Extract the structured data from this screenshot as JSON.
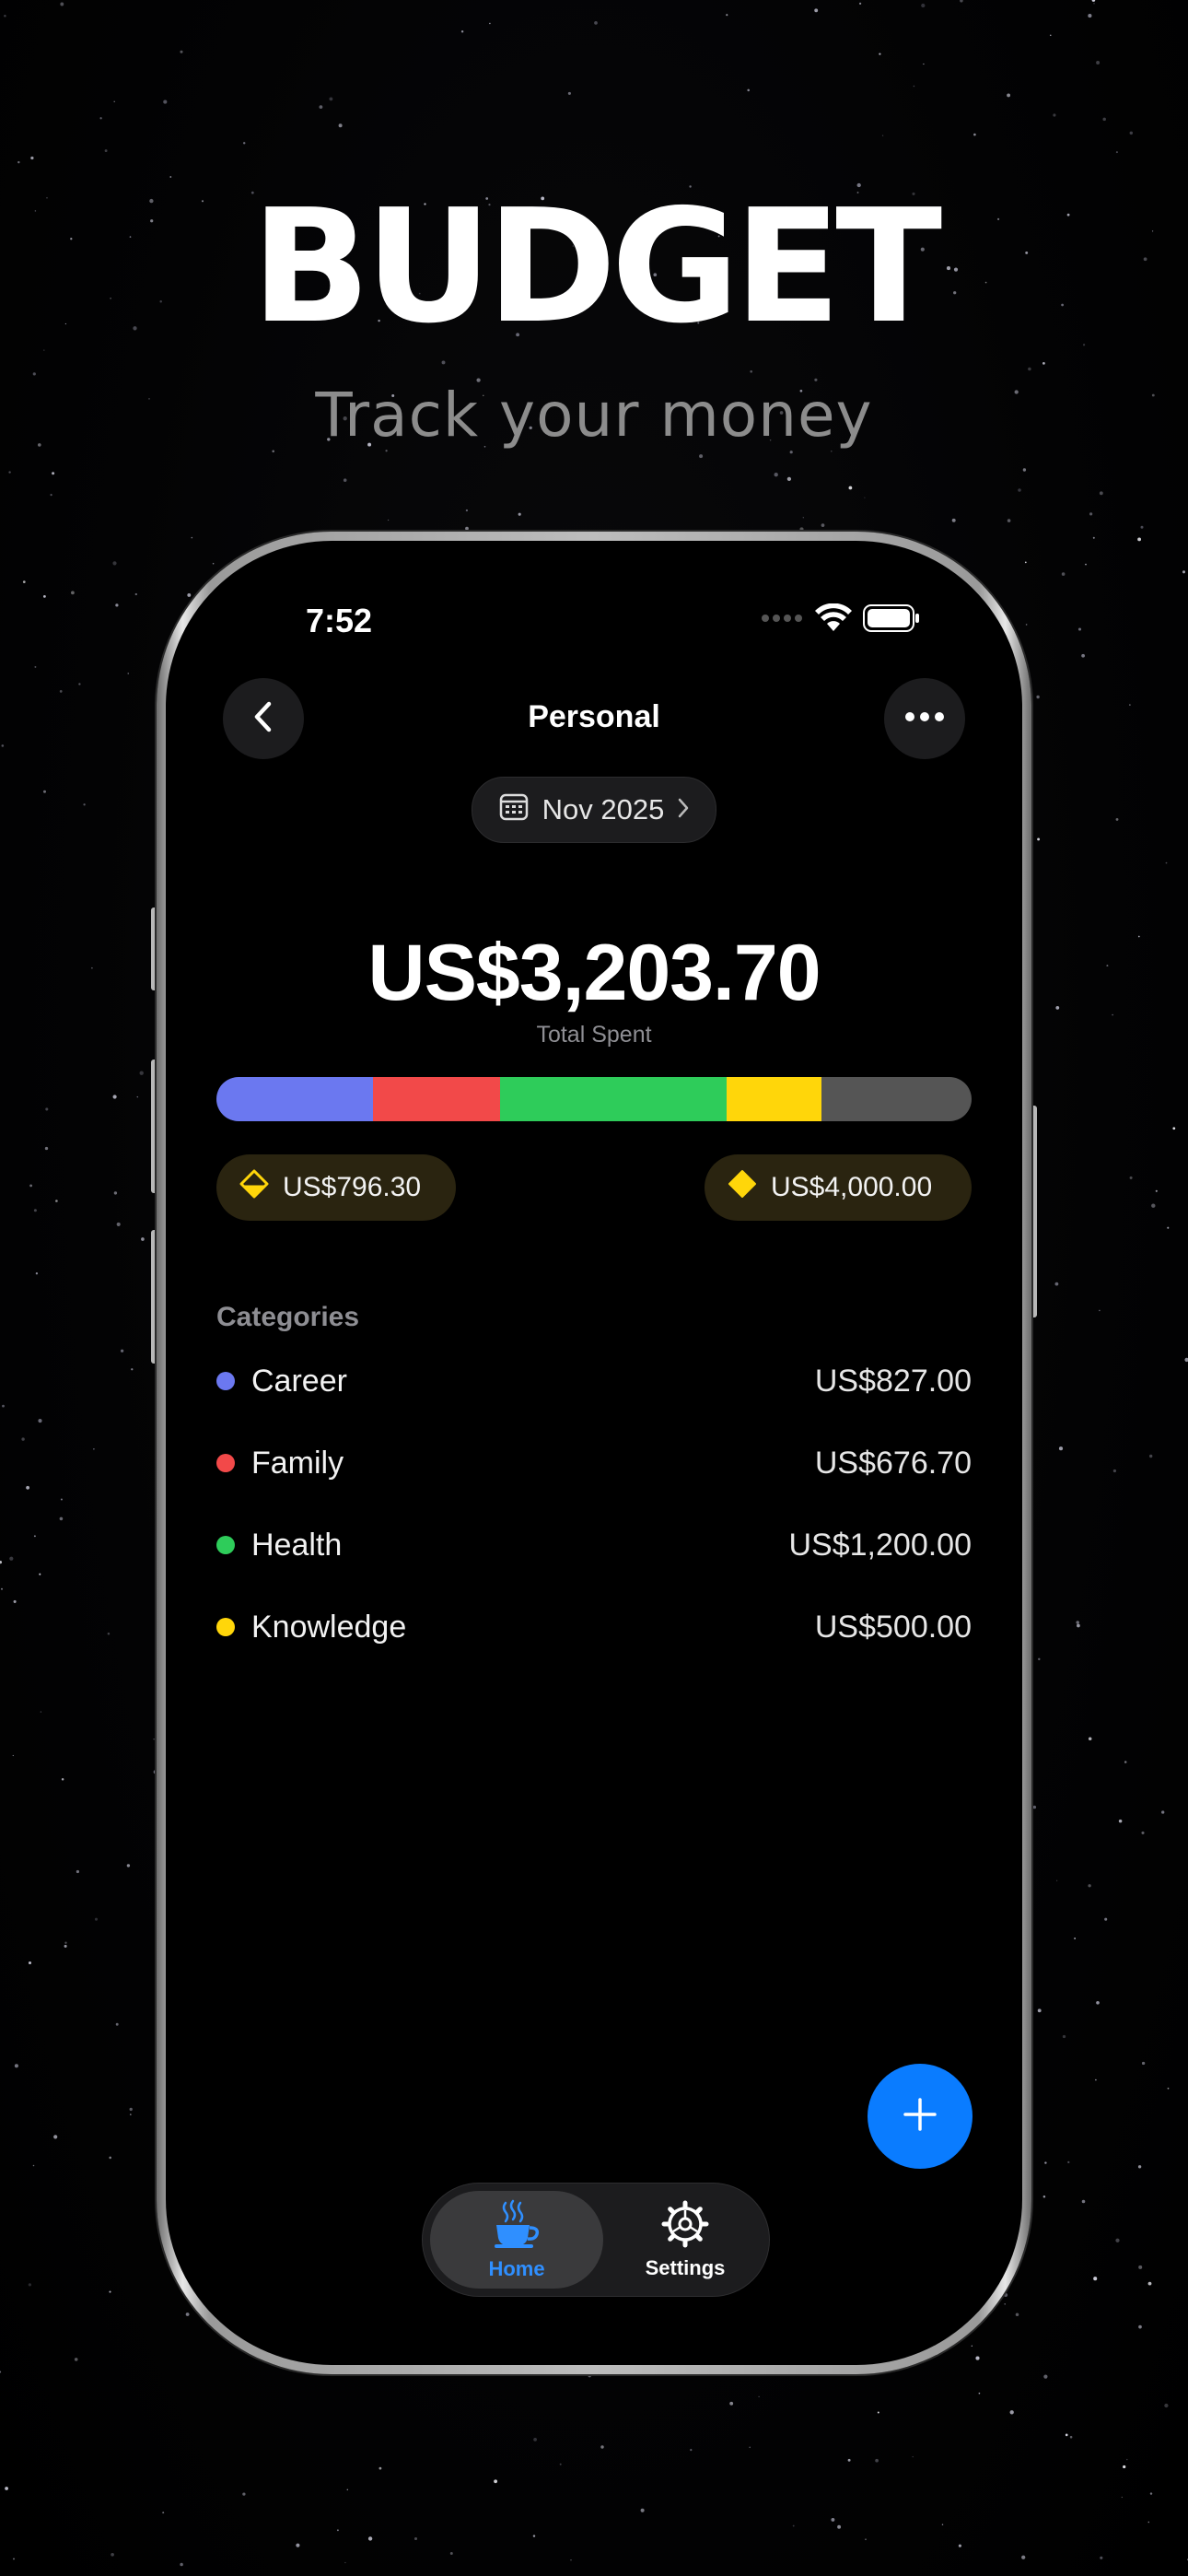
{
  "headline": "BUDGET",
  "subline": "Track your money",
  "status": {
    "time": "7:52"
  },
  "nav": {
    "title": "Personal",
    "back_icon": "chevron-left-icon",
    "more_icon": "ellipsis-icon"
  },
  "period": {
    "label": "Nov 2025",
    "icon": "calendar-icon"
  },
  "summary": {
    "total": "US$3,203.70",
    "total_label": "Total Spent"
  },
  "budget_bar": {
    "segments": [
      {
        "category": "Career",
        "value": 827.0,
        "color": "#6b78f0"
      },
      {
        "category": "Family",
        "value": 676.7,
        "color": "#f24949"
      },
      {
        "category": "Health",
        "value": 1200.0,
        "color": "#2ecc5a"
      },
      {
        "category": "Knowledge",
        "value": 500.0,
        "color": "#ffd60a"
      },
      {
        "category": "Remaining",
        "value": 796.3,
        "color": "#555555"
      }
    ]
  },
  "chips": {
    "remaining": {
      "value": "US$796.30",
      "icon": "half-diamond-icon"
    },
    "budget": {
      "value": "US$4,000.00",
      "icon": "diamond-icon"
    }
  },
  "categories": {
    "heading": "Categories",
    "items": [
      {
        "name": "Career",
        "value": "US$827.00",
        "color": "#6b78f0"
      },
      {
        "name": "Family",
        "value": "US$676.70",
        "color": "#f24949"
      },
      {
        "name": "Health",
        "value": "US$1,200.00",
        "color": "#2ecc5a"
      },
      {
        "name": "Knowledge",
        "value": "US$500.00",
        "color": "#ffd60a"
      }
    ]
  },
  "tabs": [
    {
      "label": "Home",
      "icon": "coffee-cup-icon",
      "active": true,
      "color": "#2f8fff"
    },
    {
      "label": "Settings",
      "icon": "gear-icon",
      "active": false,
      "color": "#ffffff"
    }
  ],
  "fab": {
    "icon": "plus-icon",
    "color": "#0a7cff"
  }
}
